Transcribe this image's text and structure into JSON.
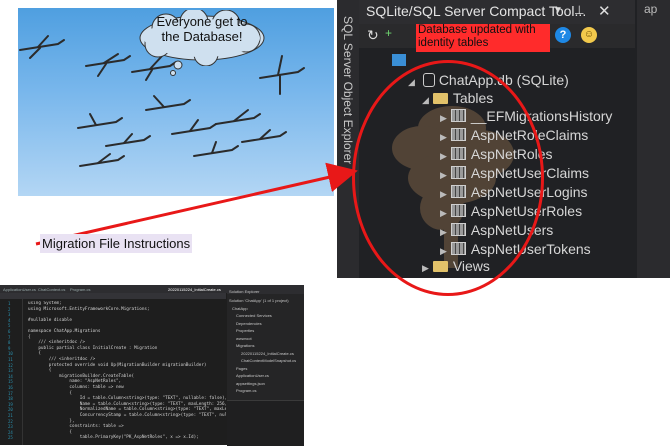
{
  "cloud": {
    "text": "Everyone get to the Database!"
  },
  "annotation": {
    "highlight_text": "Database updated with identity tables",
    "migration_label": "Migration File Instructions"
  },
  "explorer": {
    "title": "SQLite/SQL Server Compact Tool...",
    "side_label": "SQL Server Object Explorer",
    "right_label": "ap",
    "database": "ChatApp.db (SQLite)",
    "tables_folder": "Tables",
    "tables": [
      "__EFMigrationsHistory",
      "AspNetRoleClaims",
      "AspNetRoles",
      "AspNetUserClaims",
      "AspNetUserLogins",
      "AspNetUserRoles",
      "AspNetUsers",
      "AspNetUserTokens"
    ],
    "views_folder": "Views"
  },
  "vs": {
    "menu": [
      "ApplicationUser.cs",
      "ChatContext.cs",
      "Program.cs",
      "20220115224_InitialCreate.cs"
    ],
    "solution_title": "Solution Explorer",
    "solution_items": [
      "Solution 'ChatApp' (1 of 1 project)",
      "ChatApp",
      "Connected Services",
      "Dependencies",
      "Properties",
      "wwwroot",
      "Migrations",
      "20220115224_InitialCreate.cs",
      "ChatContextModelSnapshot.cs",
      "Pages",
      "ApplicationUser.cs",
      "appsettings.json",
      "Program.cs"
    ],
    "code_lines": [
      "using System;",
      "using Microsoft.EntityFrameworkCore.Migrations;",
      "",
      "#nullable disable",
      "",
      "namespace ChatApp.Migrations",
      "{",
      "    /// <inheritdoc />",
      "    public partial class InitialCreate : Migration",
      "    {",
      "        /// <inheritdoc />",
      "        protected override void Up(MigrationBuilder migrationBuilder)",
      "        {",
      "            migrationBuilder.CreateTable(",
      "                name: \"AspNetRoles\",",
      "                columns: table => new",
      "                {",
      "                    Id = table.Column<string>(type: \"TEXT\", nullable: false),",
      "                    Name = table.Column<string>(type: \"TEXT\", maxLength: 256, nullable: true),",
      "                    NormalizedName = table.Column<string>(type: \"TEXT\", maxLength: 256, nullable: true),",
      "                    ConcurrencyStamp = table.Column<string>(type: \"TEXT\", nullable: true)",
      "                },",
      "                constraints: table =>",
      "                {",
      "                    table.PrimaryKey(\"PK_AspNetRoles\", x => x.Id);"
    ]
  }
}
